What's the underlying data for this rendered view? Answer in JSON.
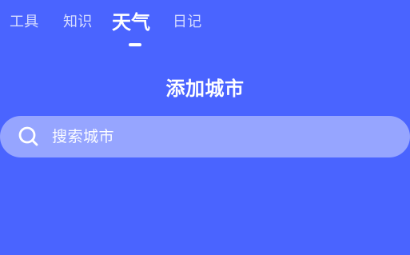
{
  "tabs": [
    {
      "label": "工具"
    },
    {
      "label": "知识"
    },
    {
      "label": "天气",
      "active": true
    },
    {
      "label": "日记"
    }
  ],
  "page": {
    "title": "添加城市"
  },
  "search": {
    "placeholder": "搜索城市"
  },
  "icons": {
    "search": "search-icon"
  },
  "colors": {
    "background": "#4a64ff",
    "search_bar": "rgba(255,255,255,0.42)",
    "text": "#ffffff"
  }
}
